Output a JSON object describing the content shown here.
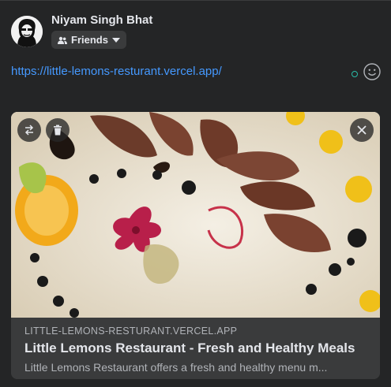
{
  "author": {
    "name": "Niyam Singh Bhat"
  },
  "audience": {
    "label": "Friends",
    "icon": "friends-icon"
  },
  "post": {
    "text": "https://little-lemons-resturant.vercel.app/"
  },
  "link_preview": {
    "domain": "LITTLE-LEMONS-RESTURANT.VERCEL.APP",
    "title": "Little Lemons Restaurant - Fresh and Healthy Meals",
    "description": "Little Lemons Restaurant offers a fresh and healthy menu m...",
    "buttons": [
      "swap-icon",
      "trash-icon",
      "close-icon"
    ]
  },
  "colors": {
    "background": "#242526",
    "link": "#4599ff",
    "card": "#3a3b3c",
    "accent_dot": "#2abba7"
  }
}
